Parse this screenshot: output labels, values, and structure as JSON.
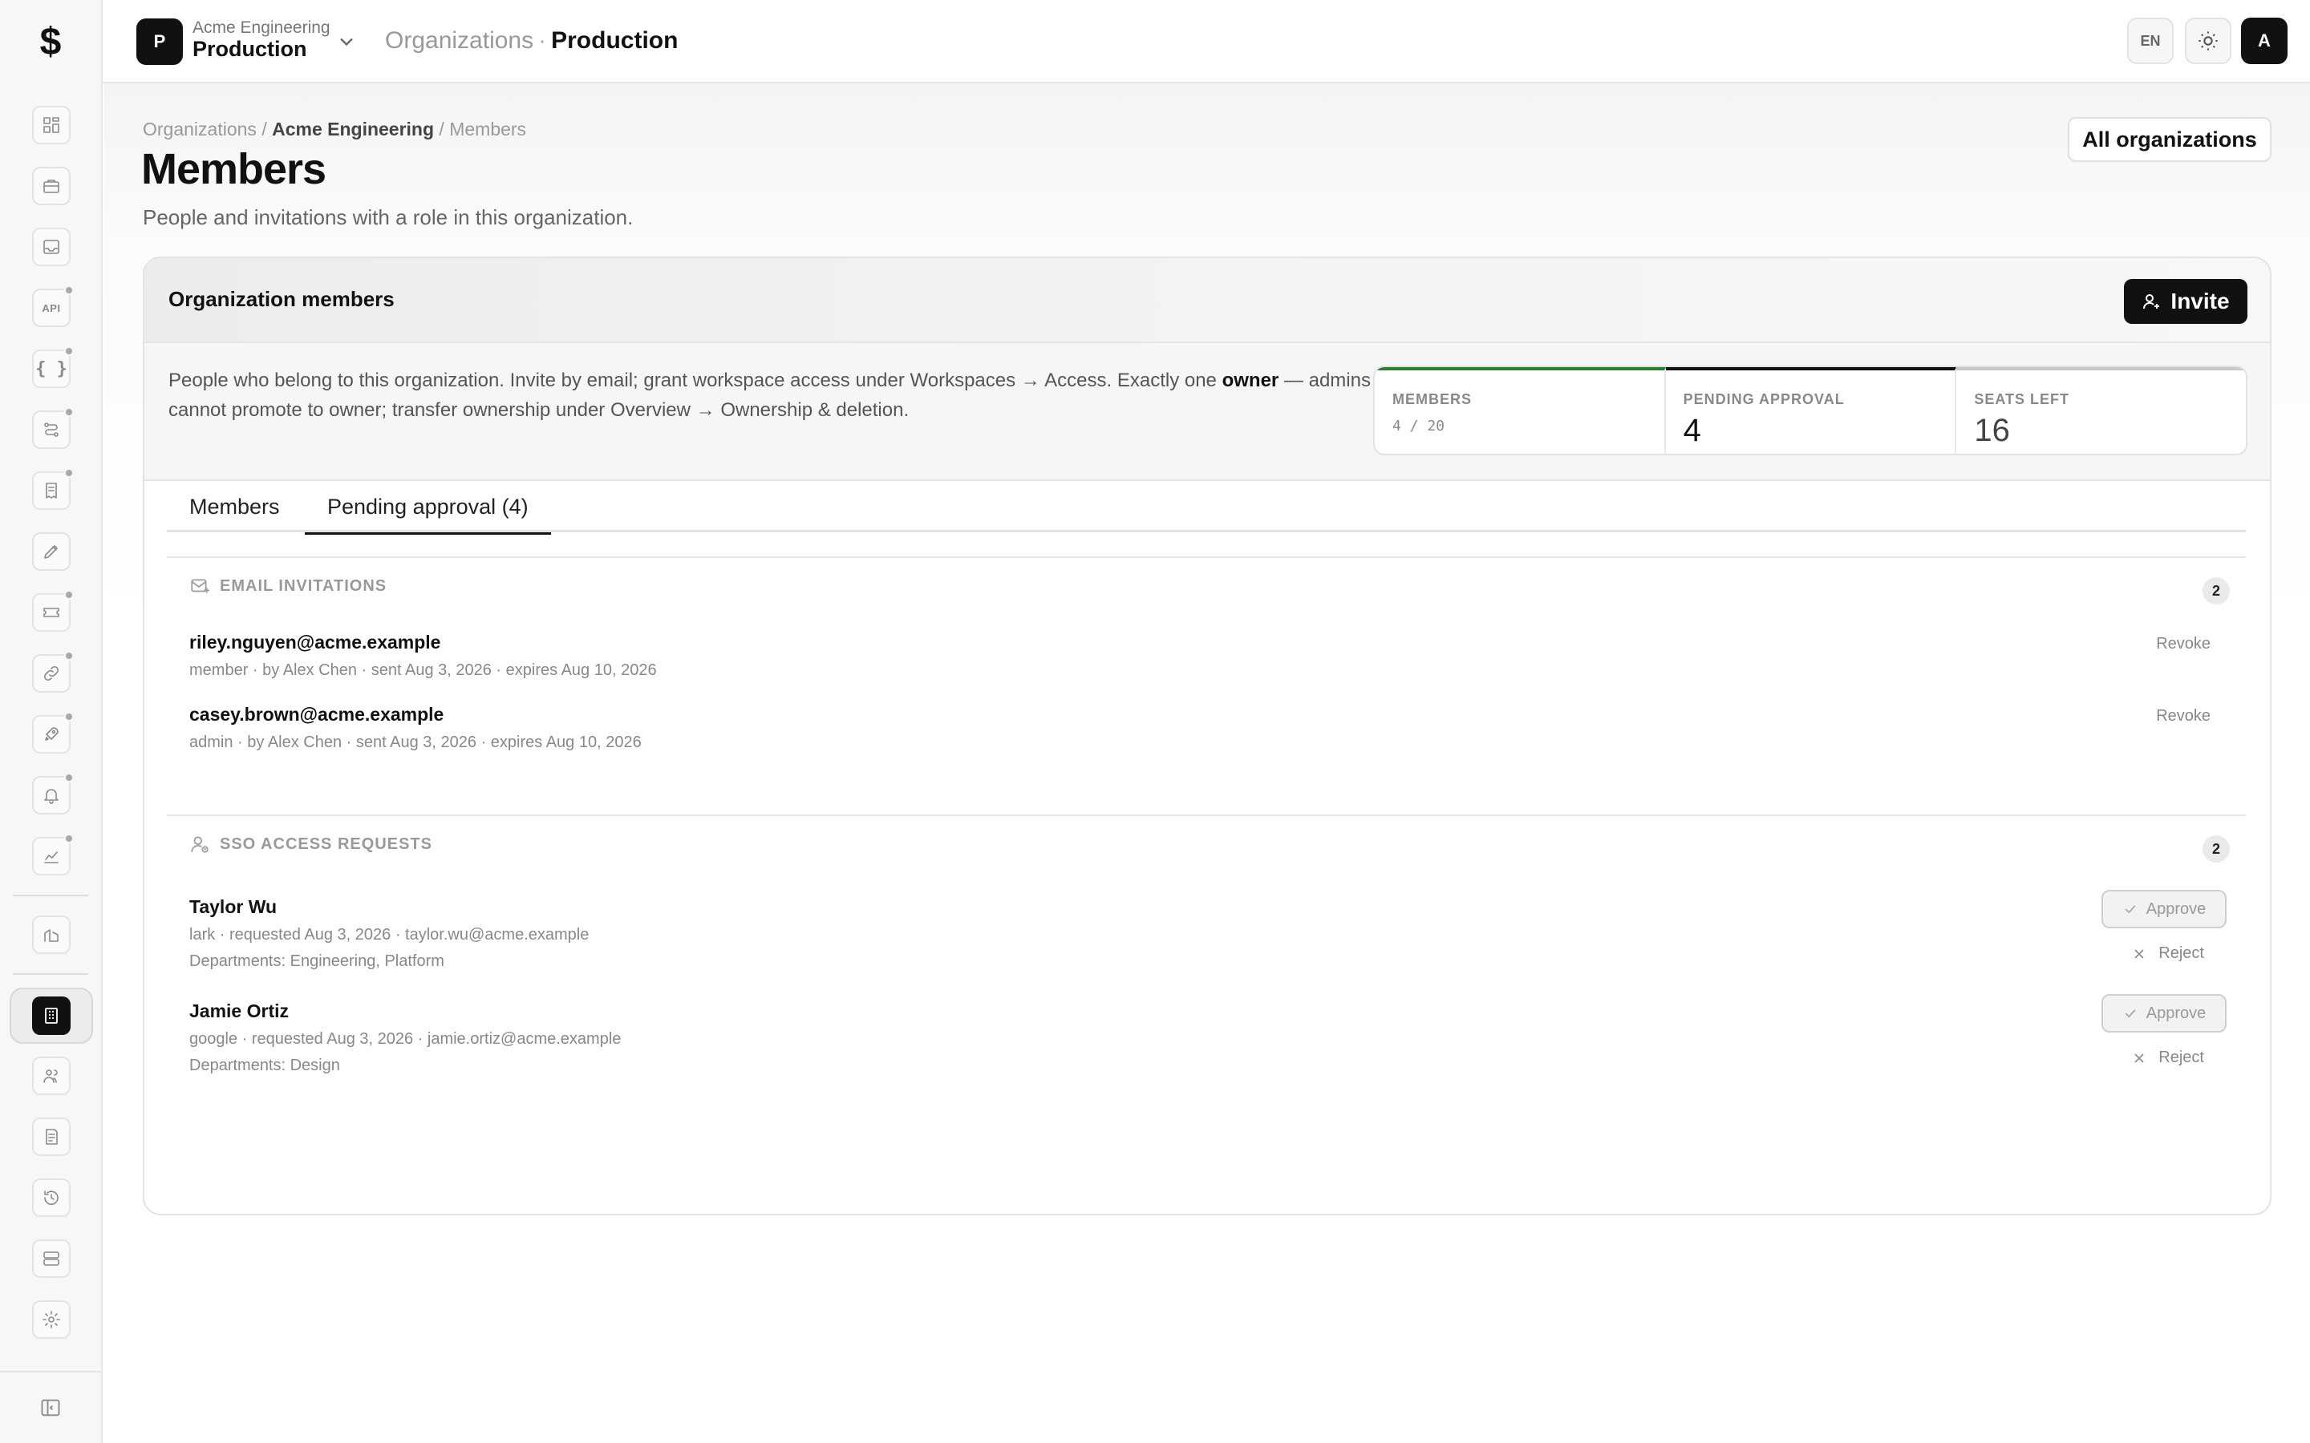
{
  "sidebar": {
    "logo": "$",
    "icons": [
      "dashboard-icon",
      "briefcase-icon",
      "inbox-icon",
      "api-icon",
      "braces-icon",
      "workflow-icon",
      "receipt-icon",
      "pen-icon",
      "ticket-icon",
      "link-icon",
      "rocket-icon",
      "bell-icon",
      "chart-icon",
      "building-icon",
      "organization-icon",
      "users-icon",
      "report-icon",
      "history-icon",
      "storage-icon",
      "gear-icon",
      "sidebar-toggle-icon"
    ],
    "api_label": "API",
    "braces_label": "{ }"
  },
  "topbar": {
    "org_initial": "P",
    "org_name": "Acme Engineering",
    "workspace_name": "Production",
    "crumb_parent": "Organizations",
    "crumb_sep": "·",
    "crumb_current": "Production",
    "lang": "EN",
    "avatar_initial": "A"
  },
  "page": {
    "breadcrumb": {
      "root": "Organizations",
      "mid": "Acme Engineering",
      "leaf": "Members",
      "sep": "/"
    },
    "title": "Members",
    "subtitle": "People and invitations with a role in this organization.",
    "all_orgs_label": "All organizations"
  },
  "card": {
    "title": "Organization members",
    "invite_label": "Invite",
    "info_part1": "People who belong to this organization. Invite by email; grant workspace access under Workspaces → Access. Exactly one ",
    "info_bold": "owner",
    "info_part2": " — admins cannot promote to owner; transfer ownership under Overview → Ownership & deletion.",
    "stats": [
      {
        "label": "MEMBERS",
        "value": "4 / 20"
      },
      {
        "label": "PENDING APPROVAL",
        "value": "4"
      },
      {
        "label": "SEATS LEFT",
        "value": "16"
      }
    ],
    "colors": {
      "members_bar": "#2e7d32",
      "pending_bar": "#111111",
      "seats_bar": "#c8c8c8"
    },
    "tabs": [
      {
        "label": "Members"
      },
      {
        "label": "Pending approval (4)"
      }
    ]
  },
  "email_invitations": {
    "label": "EMAIL INVITATIONS",
    "count": "2",
    "revoke_label": "Revoke",
    "items": [
      {
        "email": "riley.nguyen@acme.example",
        "meta": "member · by Alex Chen · sent Aug 3, 2026 · expires Aug 10, 2026"
      },
      {
        "email": "casey.brown@acme.example",
        "meta": "admin · by Alex Chen · sent Aug 3, 2026 · expires Aug 10, 2026"
      }
    ]
  },
  "sso_requests": {
    "label": "SSO ACCESS REQUESTS",
    "count": "2",
    "approve_label": "Approve",
    "reject_label": "Reject",
    "items": [
      {
        "name": "Taylor Wu",
        "meta": "lark · requested Aug 3, 2026 · taylor.wu@acme.example",
        "departments": "Departments: Engineering, Platform"
      },
      {
        "name": "Jamie Ortiz",
        "meta": "google · requested Aug 3, 2026 · jamie.ortiz@acme.example",
        "departments": "Departments: Design"
      }
    ]
  }
}
